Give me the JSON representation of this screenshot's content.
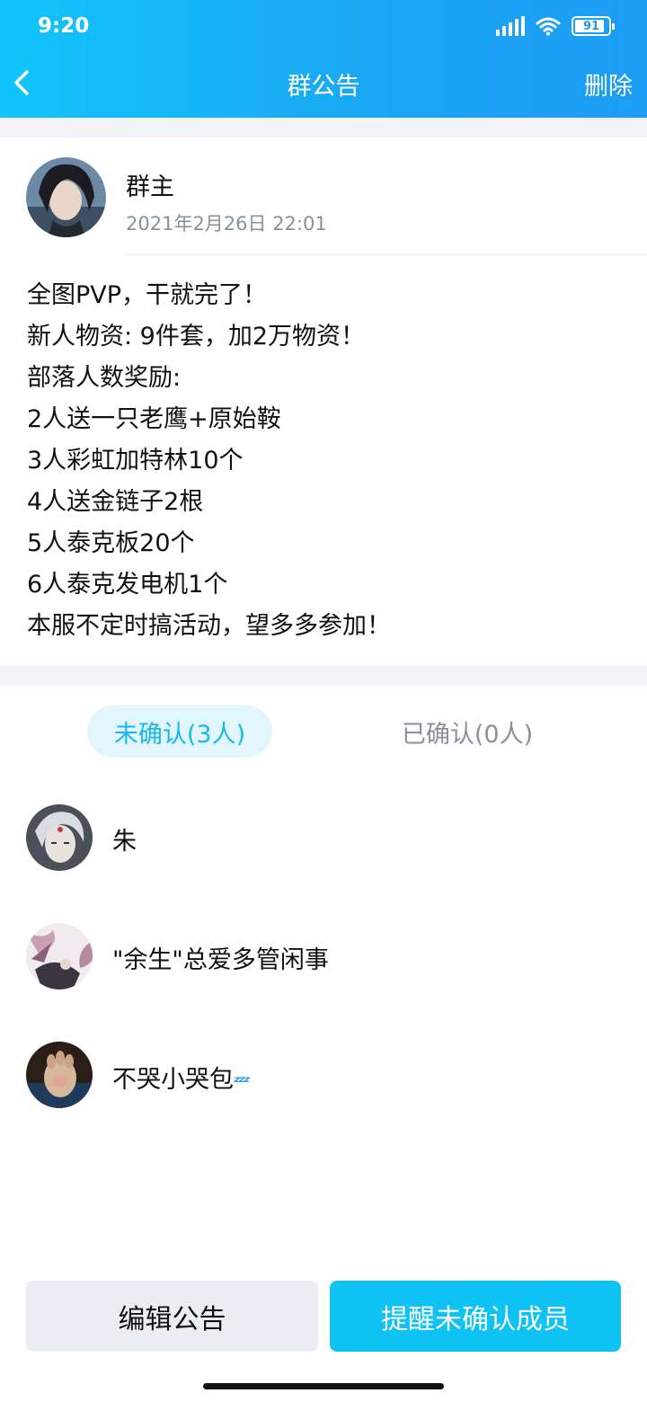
{
  "status_bar": {
    "time": "9:20",
    "battery": "91",
    "battery_level": 0.91,
    "icons": [
      "signal-icon",
      "wifi-icon",
      "battery-icon"
    ]
  },
  "nav": {
    "back_icon": "chevron-left-icon",
    "title": "群公告",
    "delete_label": "删除"
  },
  "post": {
    "author": "群主",
    "date": "2021年2月26日 22:01",
    "lines": [
      "全图PVP，干就完了！",
      "新人物资: 9件套，加2万物资！",
      "部落人数奖励:",
      "2人送一只老鹰+原始鞍",
      "3人彩虹加特林10个",
      "4人送金链子2根",
      "5人泰克板20个",
      "6人泰克发电机1个",
      "本服不定时搞活动，望多多参加！"
    ]
  },
  "tabs": {
    "unconfirmed": "未确认(3人)",
    "confirmed": "已确认(0人)",
    "active": "unconfirmed"
  },
  "members": [
    {
      "name": "朱"
    },
    {
      "name": "\"余生\"总爱多管闲事"
    },
    {
      "name": "不哭小哭包"
    }
  ],
  "buttons": {
    "edit": "编辑公告",
    "remind": "提醒未确认成员"
  },
  "colors": {
    "header_start": "#12c4fb",
    "header_end": "#1d9cf4",
    "accent": "#19b7f2",
    "remind_button": "#0fc2f4"
  }
}
